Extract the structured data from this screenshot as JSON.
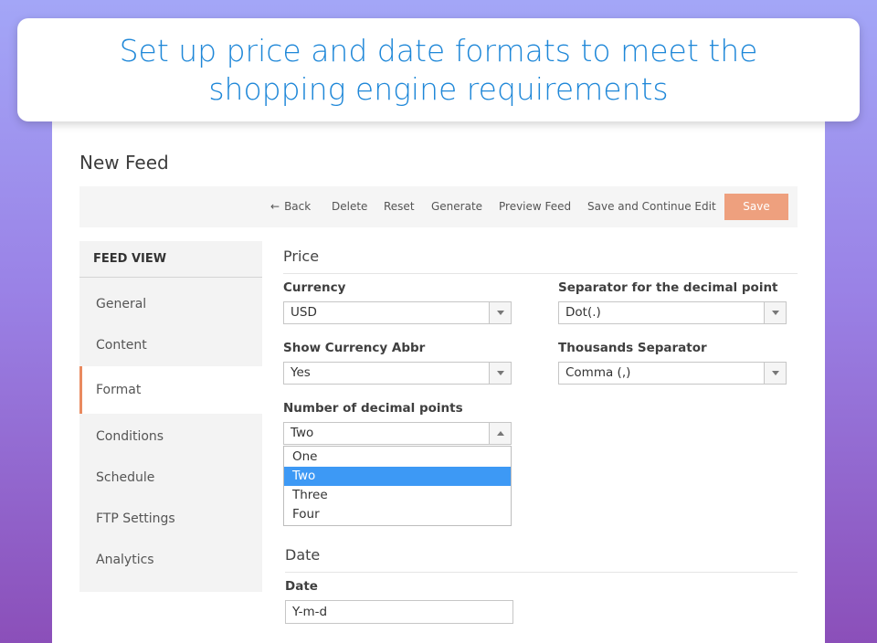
{
  "banner": {
    "headline": "Set up price and date formats to meet the shopping engine requirements"
  },
  "page": {
    "title": "New Feed"
  },
  "toolbar": {
    "back_label": "Back",
    "back_icon": "arrow-left-icon",
    "delete_label": "Delete",
    "reset_label": "Reset",
    "generate_label": "Generate",
    "preview_label": "Preview Feed",
    "save_continue_label": "Save and Continue Edit",
    "save_label": "Save"
  },
  "sidebar": {
    "header": "FEED VIEW",
    "items": [
      {
        "label": "General"
      },
      {
        "label": "Content"
      },
      {
        "label": "Format",
        "active": true
      },
      {
        "label": "Conditions"
      },
      {
        "label": "Schedule"
      },
      {
        "label": "FTP Settings"
      },
      {
        "label": "Analytics"
      }
    ]
  },
  "price": {
    "title": "Price",
    "currency": {
      "label": "Currency",
      "value": "USD"
    },
    "decimal_separator": {
      "label": "Separator for the decimal point",
      "value": "Dot(.)"
    },
    "show_currency_abbr": {
      "label": "Show Currency Abbr",
      "value": "Yes"
    },
    "thousands_separator": {
      "label": "Thousands Separator",
      "value": "Comma (,)"
    },
    "decimal_points": {
      "label": "Number of decimal points",
      "value": "Two",
      "options": [
        "One",
        "Two",
        "Three",
        "Four"
      ],
      "expanded": true
    }
  },
  "date": {
    "title": "Date",
    "format": {
      "label": "Date",
      "value": "Y-m-d"
    }
  },
  "colors": {
    "banner_text": "#1e87d8",
    "save_button": "#eea07e",
    "active_indicator": "#e98a5f",
    "selected_option": "#3d99f5"
  }
}
